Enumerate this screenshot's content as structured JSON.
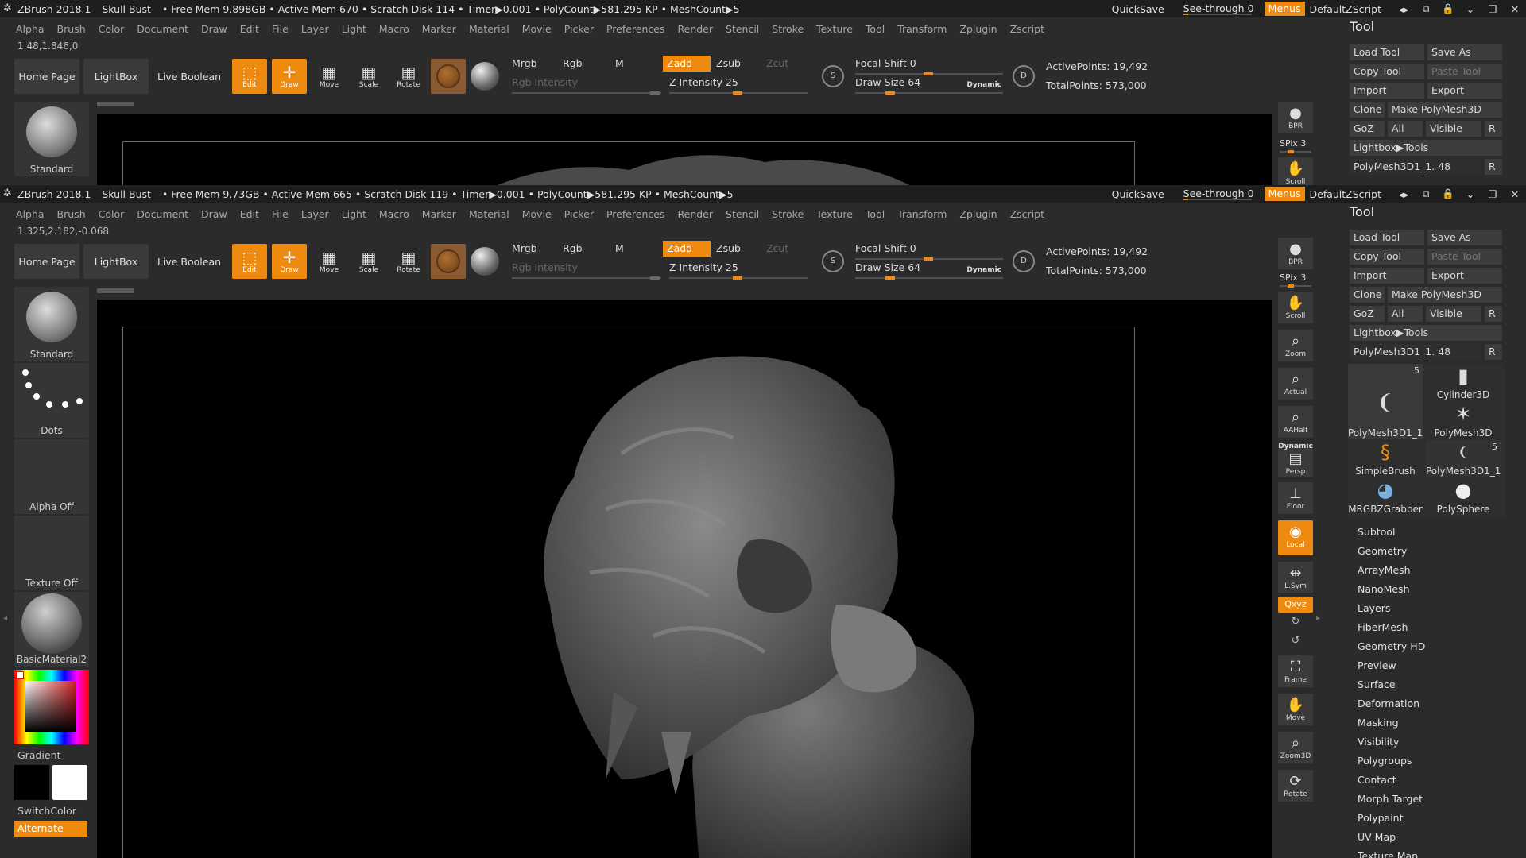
{
  "colors": {
    "accent": "#ef8a10",
    "bg": "#2b2b2b",
    "canvas": "#000000"
  },
  "instA": {
    "title": {
      "app": "ZBrush 2018.1",
      "project": "Skull Bust",
      "stats": "• Free Mem 9.898GB • Active Mem 670 • Scratch Disk 114 • Timer▶0.001 • PolyCount▶581.295 KP • MeshCount▶5"
    },
    "coords": "1.48,1.846,0"
  },
  "instB": {
    "title": {
      "app": "ZBrush 2018.1",
      "project": "Skull Bust",
      "stats": "• Free Mem 9.73GB • Active Mem 665 • Scratch Disk 119 • Timer▶0.001 • PolyCount▶581.295 KP • MeshCount▶5"
    },
    "coords": "1.325,2.182,-0.068"
  },
  "titlebar": {
    "quicksave": "QuickSave",
    "see_through_label": "See-through",
    "see_through_value": "0",
    "menus": "Menus",
    "script": "DefaultZScript"
  },
  "menu": [
    "Alpha",
    "Brush",
    "Color",
    "Document",
    "Draw",
    "Edit",
    "File",
    "Layer",
    "Light",
    "Macro",
    "Marker",
    "Material",
    "Movie",
    "Picker",
    "Preferences",
    "Render",
    "Stencil",
    "Stroke",
    "Texture",
    "Tool",
    "Transform",
    "Zplugin",
    "Zscript"
  ],
  "shelf": {
    "home": "Home Page",
    "lightbox": "LightBox",
    "live_boolean": "Live Boolean",
    "edit": "Edit",
    "draw": "Draw",
    "move": "Move",
    "scale": "Scale",
    "rotate": "Rotate"
  },
  "mrgb": {
    "mrgb": "Mrgb",
    "rgb": "Rgb",
    "m": "M",
    "zadd": "Zadd",
    "zsub": "Zsub",
    "zcut": "Zcut",
    "rgb_intensity": "Rgb Intensity",
    "z_intensity": "Z Intensity 25"
  },
  "draw": {
    "focal_shift": "Focal Shift 0",
    "draw_size": "Draw Size 64",
    "dynamic": "Dynamic",
    "s": "S",
    "d": "D"
  },
  "stats": {
    "active": "ActivePoints: 19,492",
    "total": "TotalPoints: 573,000"
  },
  "left": {
    "brush": "Standard",
    "stroke": "Dots",
    "alpha": "Alpha Off",
    "texture": "Texture Off",
    "material": "BasicMaterial2",
    "gradient": "Gradient",
    "switch": "SwitchColor",
    "alternate": "Alternate"
  },
  "rightshelf": {
    "bpr": "BPR",
    "spix": "SPix 3",
    "scroll": "Scroll",
    "zoom": "Zoom",
    "actual": "Actual",
    "aahalf": "AAHalf",
    "dynamic": "Dynamic",
    "persp": "Persp",
    "floor": "Floor",
    "local": "Local",
    "lsym": "L.Sym",
    "xyz": "Qxyz",
    "frame": "Frame",
    "move": "Move",
    "zoom3d": "Zoom3D",
    "rotate": "Rotate"
  },
  "tool": {
    "header": "Tool",
    "load": "Load Tool",
    "save_as": "Save As",
    "copy": "Copy Tool",
    "paste": "Paste Tool",
    "import": "Import",
    "export": "Export",
    "clone": "Clone",
    "make_poly": "Make PolyMesh3D",
    "goz": "GoZ",
    "all": "All",
    "visible": "Visible",
    "r": "R",
    "lightbox_tools": "Lightbox▶Tools",
    "current": "PolyMesh3D1_1. 48",
    "thumbs": [
      {
        "label": "PolyMesh3D1_1",
        "count": "5"
      },
      {
        "label": "Cylinder3D",
        "count": ""
      },
      {
        "label": "PolyMesh3D",
        "count": ""
      },
      {
        "label": "SimpleBrush",
        "count": ""
      },
      {
        "label": "PolyMesh3D1_1",
        "count": "5"
      },
      {
        "label": "MRGBZGrabber",
        "count": ""
      },
      {
        "label": "PolySphere",
        "count": ""
      }
    ],
    "subpalettes": [
      "Subtool",
      "Geometry",
      "ArrayMesh",
      "NanoMesh",
      "Layers",
      "FiberMesh",
      "Geometry HD",
      "Preview",
      "Surface",
      "Deformation",
      "Masking",
      "Visibility",
      "Polygroups",
      "Contact",
      "Morph Target",
      "Polypaint",
      "UV Map",
      "Texture Map"
    ]
  }
}
